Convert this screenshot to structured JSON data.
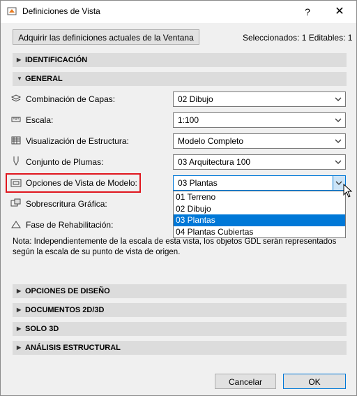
{
  "window": {
    "title": "Definiciones de Vista",
    "help_label": "?",
    "close_label": "✕"
  },
  "top": {
    "acquire_button": "Adquirir las definiciones actuales de la Ventana",
    "selection_info": "Seleccionados: 1 Editables: 1"
  },
  "sections": {
    "identificacion": "IDENTIFICACIÓN",
    "general": "GENERAL",
    "opciones_diseno": "OPCIONES DE DISEÑO",
    "documentos": "DOCUMENTOS 2D/3D",
    "solo3d": "SOLO 3D",
    "analisis": "ANÁLISIS ESTRUCTURAL"
  },
  "general": {
    "capas_label": "Combinación de Capas:",
    "capas_value": "02 Dibujo",
    "escala_label": "Escala:",
    "escala_value": "1:100",
    "estructura_label": "Visualización de Estructura:",
    "estructura_value": "Modelo Completo",
    "plumas_label": "Conjunto de Plumas:",
    "plumas_value": "03 Arquitectura 100",
    "modelo_label": "Opciones de Vista de Modelo:",
    "modelo_value": "03 Plantas",
    "sobrescritura_label": "Sobrescritura Gráfica:",
    "rehabilitacion_label": "Fase de Rehabilitación:"
  },
  "dropdown": {
    "options": [
      "01 Terreno",
      "02 Dibujo",
      "03 Plantas",
      "04 Plantas Cubiertas"
    ],
    "selected_index": 2
  },
  "note": "Nota: Independientemente de la escala de esta vista, los objetos GDL serán representados según la escala de su punto de vista de origen.",
  "footer": {
    "cancel": "Cancelar",
    "ok": "OK"
  },
  "colors": {
    "highlight": "#e0161e",
    "selection": "#0078d7",
    "section_bg": "#dcdcdc"
  }
}
